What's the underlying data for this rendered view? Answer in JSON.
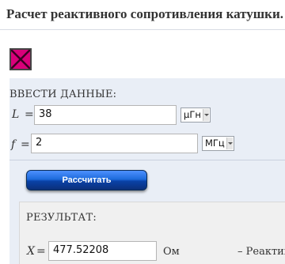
{
  "page": {
    "title": "Расчет реактивного сопротивления катушки."
  },
  "input": {
    "section_label": "ВВЕСТИ ДАННЫЕ:",
    "inductance": {
      "symbol": "L",
      "equals": "=",
      "value": "38",
      "unit": "μГн"
    },
    "frequency": {
      "symbol": "f",
      "equals": "=",
      "value": "2",
      "unit": "МГц"
    }
  },
  "actions": {
    "calculate_label": "Рассчитать"
  },
  "result": {
    "section_label": "РЕЗУЛЬТАТ:",
    "reactance": {
      "symbol": "X",
      "equals": "=",
      "value": "477.52208",
      "unit": "Ом",
      "description": "– Реактивн"
    }
  },
  "colors": {
    "panel": "#e9eef6",
    "result_box": "#f0f0f0",
    "button": "#1d6bdb",
    "broken_image": "#d9007a"
  },
  "icons": {
    "broken_image": "broken-image-icon",
    "dropdown": "chevron-down-icon"
  }
}
